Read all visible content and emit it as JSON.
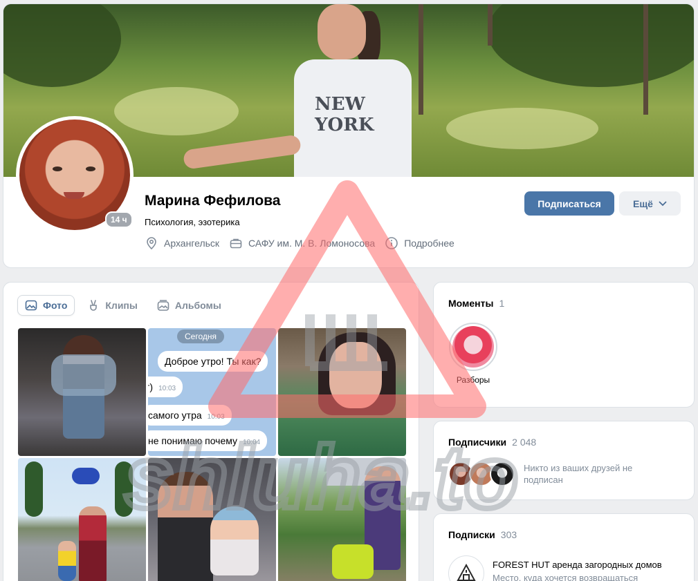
{
  "profile": {
    "name": "Марина Фефилова",
    "status": "Психология, эзотерика",
    "online_badge": "14 ч",
    "city": "Архангельск",
    "university": "САФУ им. М. В. Ломоносова",
    "details": "Подробнее",
    "subscribe_label": "Подписаться",
    "more_label": "Ещё",
    "cover_shirt_text": "NEW YORK"
  },
  "photos": {
    "tabs": [
      {
        "label": "Фото",
        "icon": "image-icon",
        "active": true
      },
      {
        "label": "Клипы",
        "icon": "clips-icon",
        "active": false
      },
      {
        "label": "Альбомы",
        "icon": "albums-icon",
        "active": false
      }
    ],
    "chat_screenshot": {
      "date_pill": "Сегодня",
      "messages": [
        {
          "text": "Доброе утро! Ты как?",
          "time": ""
        },
        {
          "text": "т)",
          "time": "10:03"
        },
        {
          "text": "самого утра",
          "time": "10:03"
        },
        {
          "text": "не понимаю почему",
          "time": "10:04"
        }
      ]
    }
  },
  "moments": {
    "title": "Моменты",
    "count": "1",
    "items": [
      {
        "label": "Разборы"
      }
    ]
  },
  "subscribers": {
    "title": "Подписчики",
    "count": "2 048",
    "no_friends": "Никто из ваших друзей не подписан"
  },
  "following": {
    "title": "Подписки",
    "count": "303",
    "items": [
      {
        "name": "FOREST HUT аренда загородных домов",
        "desc": "Место, куда хочется возвращаться"
      }
    ]
  },
  "watermark": {
    "text": "shluha.to"
  },
  "colors": {
    "accent": "#4a76a8",
    "page_bg": "#edeef0",
    "muted": "#818c99",
    "watermark": "#ff6b6b"
  }
}
